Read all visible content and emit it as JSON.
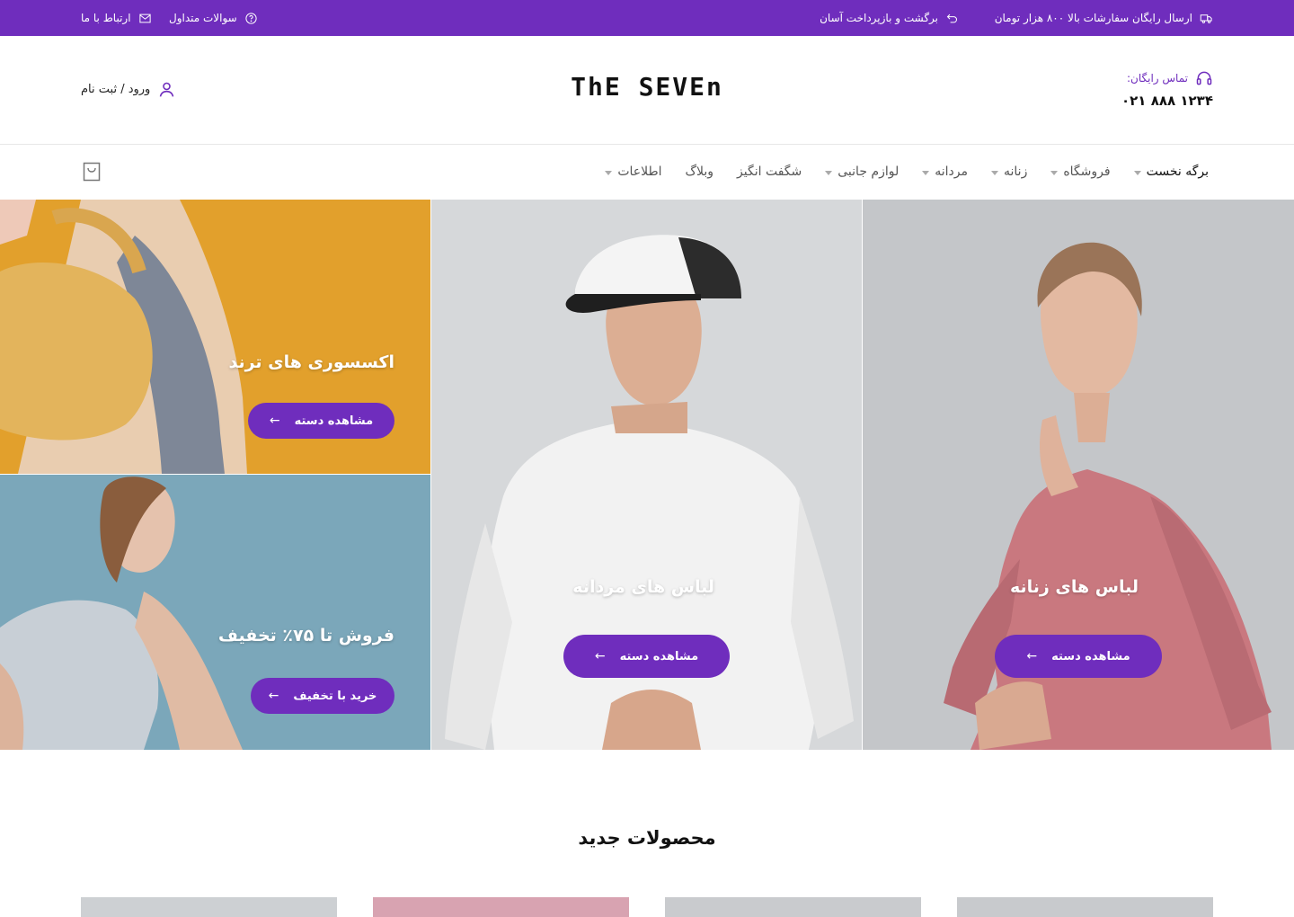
{
  "topbar": {
    "shipping": "ارسال رایگان سفارشات بالا ۸۰۰ هزار تومان",
    "returns": "برگشت و بازپرداخت آسان",
    "faq": "سوالات متداول",
    "contact": "ارتباط با ما",
    "bg_color": "#6f2dbd"
  },
  "header": {
    "phone_label": "تماس رایگان:",
    "phone_number": "۰۲۱ ۸۸۸ ۱۲۳۴",
    "logo": "ThE SEVEn",
    "login": "ورود / ثبت نام"
  },
  "nav": {
    "items": [
      {
        "label": "برگه نخست"
      },
      {
        "label": "فروشگاه"
      },
      {
        "label": "زنانه"
      },
      {
        "label": "مردانه"
      },
      {
        "label": "لوازم جانبی"
      },
      {
        "label": "شگفت انگیز"
      },
      {
        "label": "وبلاگ"
      },
      {
        "label": "اطلاعات"
      }
    ]
  },
  "hero": {
    "women": {
      "title": "لباس های زنانه",
      "button": "مشاهده دسته"
    },
    "men": {
      "title": "لباس های مردانه",
      "button": "مشاهده دسته"
    },
    "accessories": {
      "title": "اکسسوری های ترند",
      "button": "مشاهده دسته"
    },
    "sale": {
      "title": "فروش تا ۷۵٪ تخفیف",
      "button": "خرید با تخفیف"
    },
    "arrow": "←"
  },
  "products": {
    "title": "محصولات جدید"
  },
  "colors": {
    "accent": "#6f2dbd"
  },
  "icons": [
    "truck-icon",
    "return-icon",
    "question-icon",
    "mail-icon",
    "headset-icon",
    "user-icon",
    "cart-icon",
    "arrow-left-icon"
  ]
}
